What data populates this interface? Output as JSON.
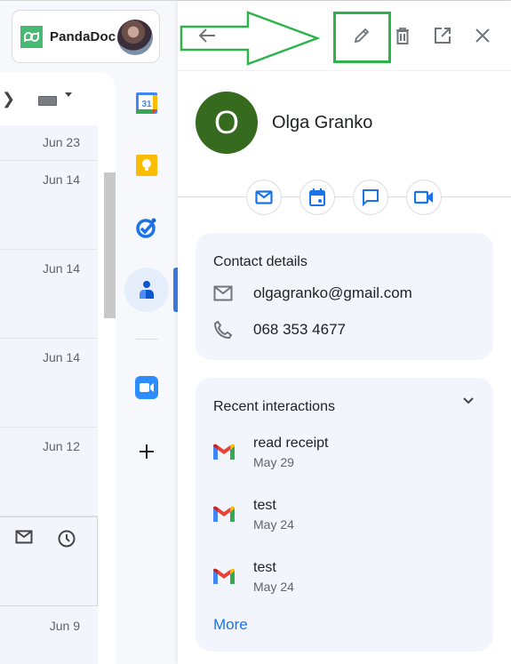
{
  "brand": {
    "name": "PandaDoc"
  },
  "mail_list": {
    "rows": [
      {
        "date": "Jun 23"
      },
      {
        "date": "Jun 14"
      },
      {
        "date": "Jun 14"
      },
      {
        "date": "Jun 14"
      },
      {
        "date": "Jun 12"
      },
      {
        "date": ""
      },
      {
        "date": "Jun 9"
      }
    ]
  },
  "rail": {
    "items": [
      {
        "name": "Calendar",
        "icon": "calendar-icon",
        "badge": "31"
      },
      {
        "name": "Keep",
        "icon": "keep-icon"
      },
      {
        "name": "Tasks",
        "icon": "tasks-icon"
      },
      {
        "name": "Contacts",
        "icon": "contacts-icon",
        "active": true
      },
      {
        "name": "Zoom",
        "icon": "zoom-icon"
      },
      {
        "name": "Get add-ons",
        "icon": "plus-icon"
      }
    ]
  },
  "panel": {
    "header": {
      "back": "back-arrow-icon",
      "edit": "pencil-icon",
      "delete": "trash-icon",
      "open": "open-in-new-icon",
      "close": "close-icon"
    },
    "contact": {
      "initial": "O",
      "name": "Olga Granko",
      "avatar_color": "#356a1f"
    },
    "actions": [
      "email",
      "calendar",
      "chat",
      "video"
    ],
    "details": {
      "title": "Contact details",
      "email": "olgagranko@gmail.com",
      "phone": "068 353 4677"
    },
    "interactions": {
      "title": "Recent interactions",
      "items": [
        {
          "subject": "read receipt",
          "date": "May 29"
        },
        {
          "subject": "test",
          "date": "May 24"
        },
        {
          "subject": "test",
          "date": "May 24"
        }
      ],
      "more": "More"
    }
  },
  "colors": {
    "accent": "#1a73e8",
    "annotation": "#2db34a"
  }
}
